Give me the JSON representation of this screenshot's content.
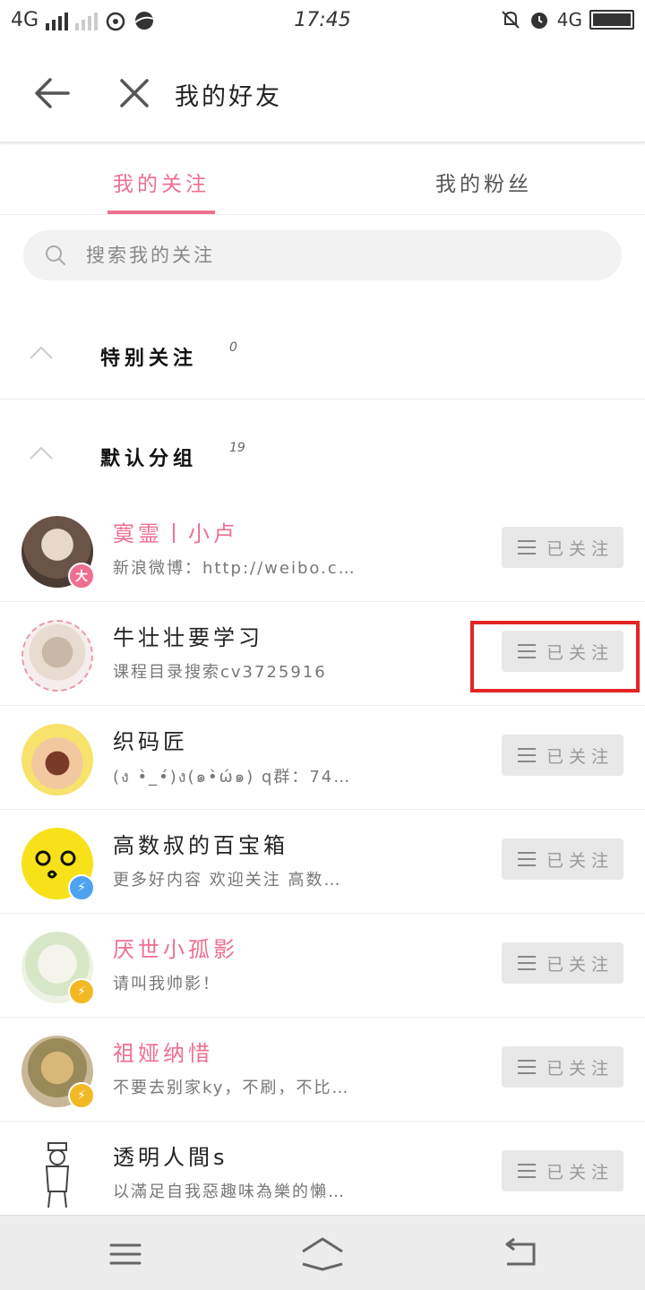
{
  "status_bar": {
    "network": "4G",
    "network_right": "4G",
    "time": "17:45"
  },
  "header": {
    "title": "我的好友",
    "back_icon": "back-arrow-icon",
    "close_icon": "close-icon"
  },
  "tabs": [
    {
      "label": "我的关注",
      "active": true
    },
    {
      "label": "我的粉丝",
      "active": false
    }
  ],
  "search": {
    "placeholder": "搜索我的关注"
  },
  "groups": [
    {
      "name": "特别关注",
      "count": "0"
    },
    {
      "name": "默认分组",
      "count": "19"
    }
  ],
  "users": [
    {
      "name": "寞霊丨小卢",
      "desc": "新浪微博：http://weibo.c…",
      "button": "已关注",
      "name_color": "#ee6f8f",
      "badge": "大"
    },
    {
      "name": "牛壮壮要学习",
      "desc": "课程目录搜索cv3725916",
      "button": "已关注",
      "name_color": "#222222",
      "badge": ""
    },
    {
      "name": "织码匠",
      "desc": "(ง •̀_•́)ง(๑•̀ώ๑) q群：74…",
      "button": "已关注",
      "name_color": "#222222",
      "badge": ""
    },
    {
      "name": "高数叔的百宝箱",
      "desc": "更多好内容 欢迎关注 高数…",
      "button": "已关注",
      "name_color": "#222222",
      "badge": "⚡"
    },
    {
      "name": "厌世小孤影",
      "desc": "请叫我帅影！",
      "button": "已关注",
      "name_color": "#ee6f8f",
      "badge": "⚡"
    },
    {
      "name": "祖娅纳惜",
      "desc": "不要去别家ky，不刷，不比…",
      "button": "已关注",
      "name_color": "#ee6f8f",
      "badge": "⚡"
    },
    {
      "name": "透明人間s",
      "desc": "以滿足自我惡趣味為樂的懶…",
      "button": "已关注",
      "name_color": "#222222",
      "badge": ""
    }
  ],
  "colors": {
    "accent": "#ee6f8f",
    "highlight": "#e52424",
    "button_bg": "#e8e8e8"
  }
}
